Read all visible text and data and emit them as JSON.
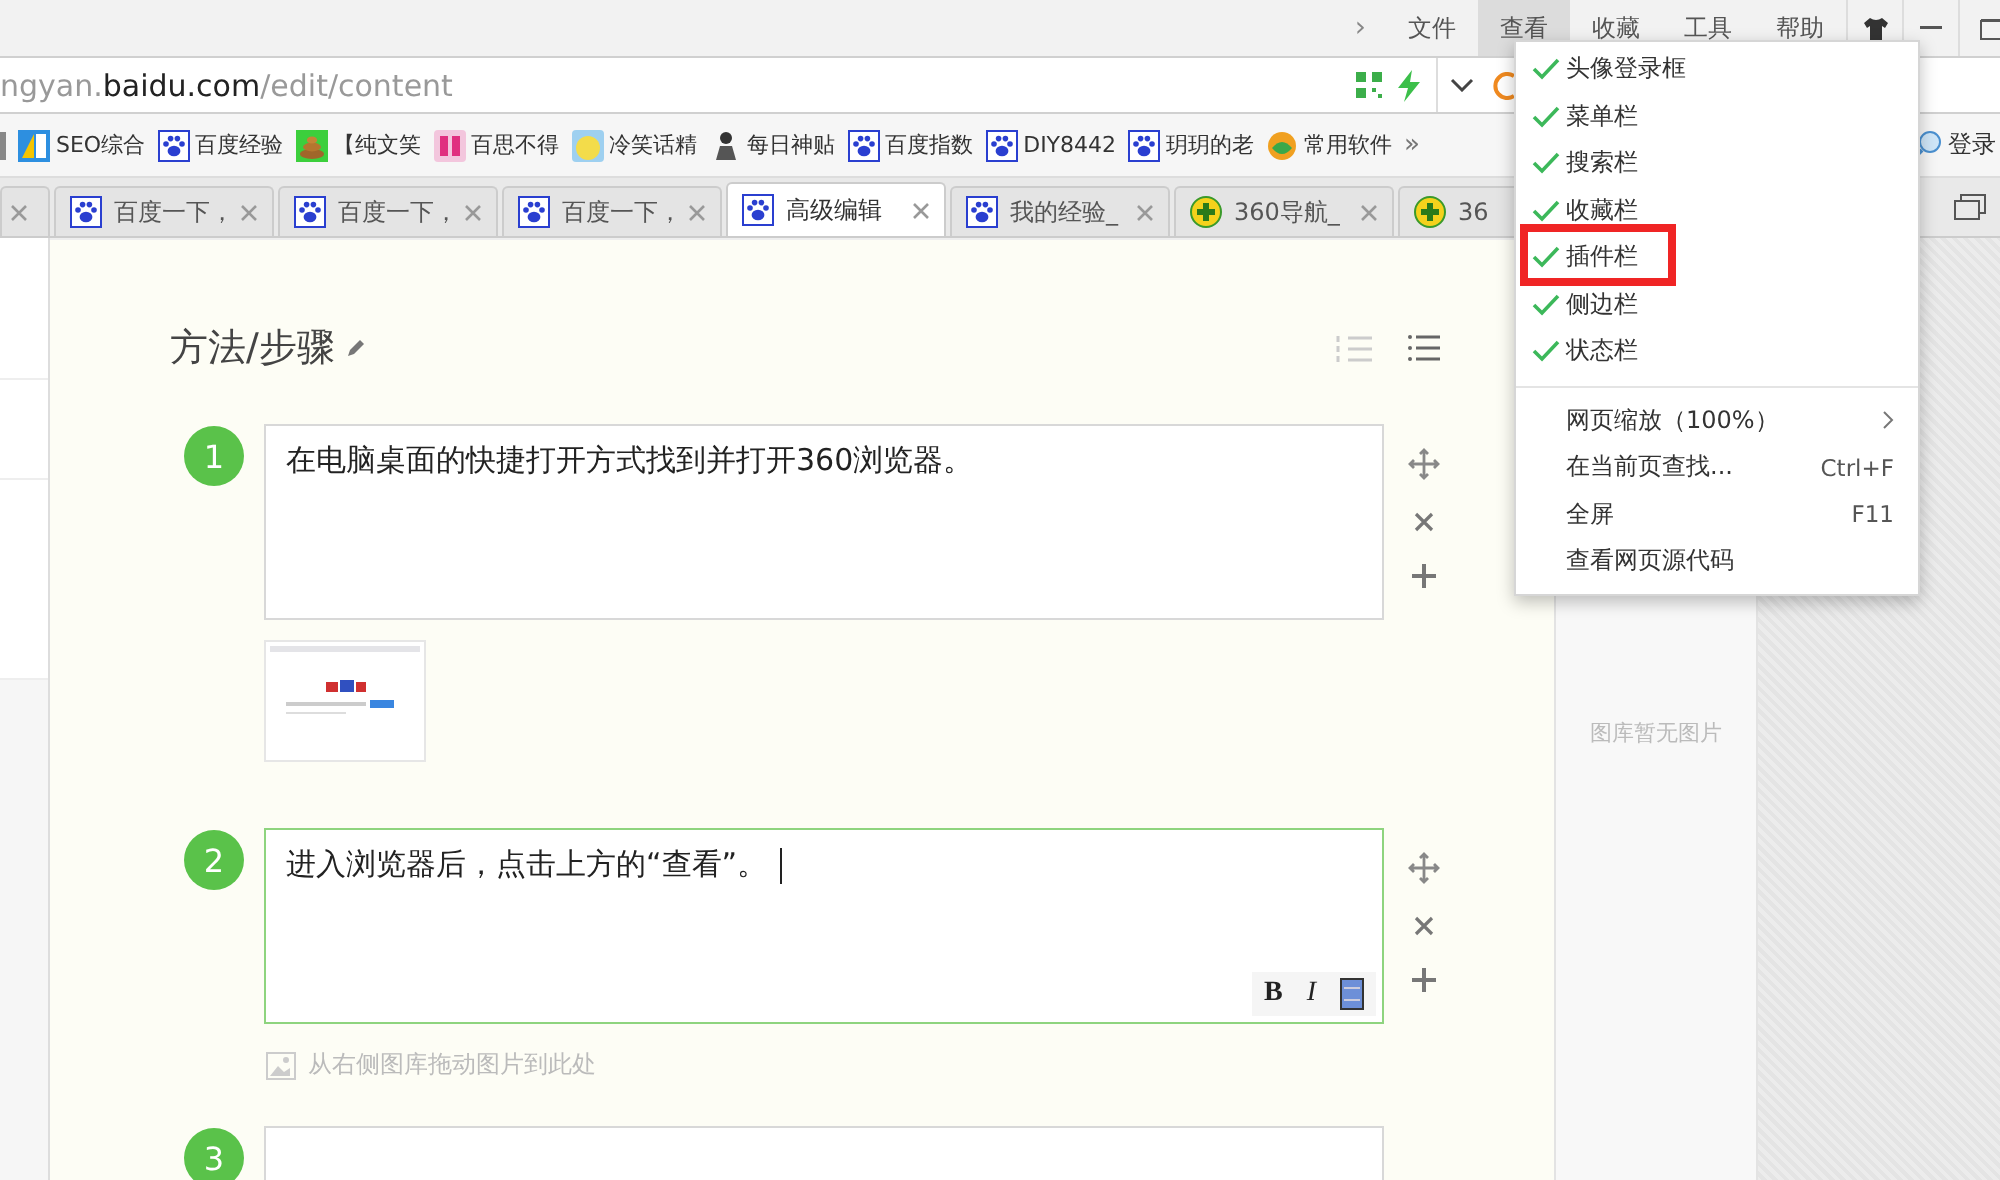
{
  "menu_bar": {
    "more": "›",
    "items": [
      {
        "label": "文件",
        "selected": false
      },
      {
        "label": "查看",
        "selected": true
      },
      {
        "label": "收藏",
        "selected": false
      },
      {
        "label": "工具",
        "selected": false
      },
      {
        "label": "帮助",
        "selected": false
      }
    ]
  },
  "address_bar": {
    "url": "ngyan.**baidu.com**/edit/content"
  },
  "bookmarks": [
    {
      "label": "SEO综合",
      "kind": "tile"
    },
    {
      "label": "百度经验",
      "kind": "paw"
    },
    {
      "label": "【纯文笑",
      "kind": "blob"
    },
    {
      "label": "百思不得",
      "kind": "glyph"
    },
    {
      "label": "冷笑话精",
      "kind": "face"
    },
    {
      "label": "每日神贴",
      "kind": "figure"
    },
    {
      "label": "百度指数",
      "kind": "paw"
    },
    {
      "label": "DIY8442",
      "kind": "paw"
    },
    {
      "label": "玥玥的老",
      "kind": "paw"
    },
    {
      "label": "常用软件",
      "kind": "swirl"
    }
  ],
  "bookmarks_more": "»",
  "login": "登录",
  "tabs": [
    {
      "label": "百度一下，",
      "kind": "paw",
      "selected": false
    },
    {
      "label": "百度一下，",
      "kind": "paw",
      "selected": false
    },
    {
      "label": "百度一下，",
      "kind": "paw",
      "selected": false
    },
    {
      "label": "高级编辑",
      "kind": "paw",
      "selected": true
    },
    {
      "label": "我的经验_",
      "kind": "paw",
      "selected": false
    },
    {
      "label": "360导航_",
      "kind": "globe",
      "selected": false
    },
    {
      "label": "36",
      "kind": "globe",
      "selected": false
    }
  ],
  "editor": {
    "heading": "方法/步骤",
    "steps": [
      {
        "number": "1",
        "text": "在电脑桌面的快捷打开方式找到并打开360浏览器。",
        "focused": false,
        "has_image": true
      },
      {
        "number": "2",
        "text": "进入浏览器后，点击上方的“查看”。",
        "focused": true,
        "has_image": false,
        "hint": "从右侧图库拖动图片到此处",
        "toolbar": {
          "bold": "B",
          "italic": "I"
        }
      },
      {
        "number": "3",
        "focused": false,
        "has_image": false
      }
    ]
  },
  "gallery": {
    "empty_text": "图库暂无图片"
  },
  "view_menu": [
    {
      "kind": "check",
      "label": "头像登录框",
      "checked": true,
      "annotated": false
    },
    {
      "kind": "check",
      "label": "菜单栏",
      "checked": true,
      "annotated": false
    },
    {
      "kind": "check",
      "label": "搜索栏",
      "checked": true,
      "annotated": false
    },
    {
      "kind": "check",
      "label": "收藏栏",
      "checked": true,
      "annotated": false
    },
    {
      "kind": "check",
      "label": "插件栏",
      "checked": true,
      "annotated": true
    },
    {
      "kind": "check",
      "label": "侧边栏",
      "checked": true,
      "annotated": false
    },
    {
      "kind": "check",
      "label": "状态栏",
      "checked": true,
      "annotated": false
    },
    {
      "kind": "separator"
    },
    {
      "kind": "submenu",
      "label": "网页缩放（100%）"
    },
    {
      "kind": "command",
      "label": "在当前页查找...",
      "shortcut": "Ctrl+F"
    },
    {
      "kind": "command",
      "label": "全屏",
      "shortcut": "F11"
    },
    {
      "kind": "command",
      "label": "查看网页源代码"
    }
  ]
}
